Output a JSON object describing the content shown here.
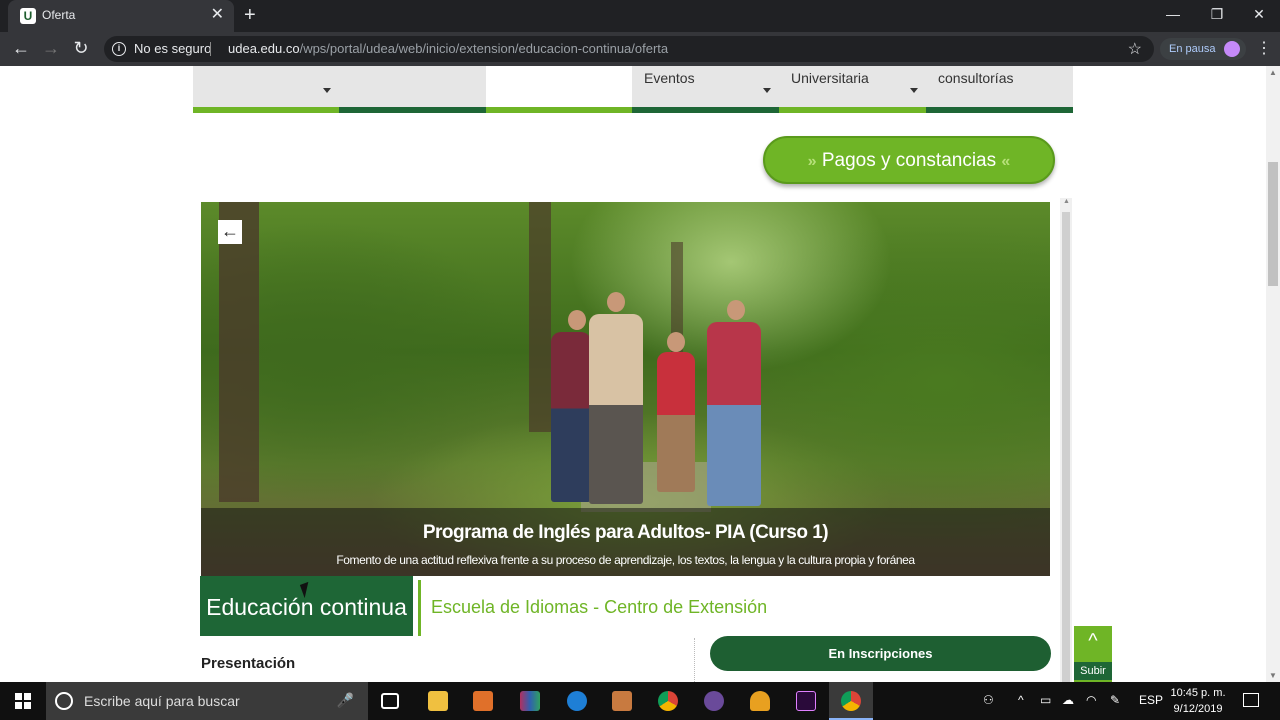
{
  "browser": {
    "tab_title": "Oferta",
    "tab_favicon_letter": "U",
    "close_symbol": "✕",
    "new_tab_symbol": "+",
    "security_label": "No es seguro",
    "url_host": "udea.edu.co",
    "url_path": "/wps/portal/udea/web/inicio/extension/educacion-continua/oferta",
    "profile_status": "En pausa"
  },
  "nav_menu": {
    "items": [
      {
        "label": ""
      },
      {
        "label": ""
      },
      {
        "label": ""
      },
      {
        "label": "Eventos"
      },
      {
        "label": "Universitaria"
      },
      {
        "label": "consultorías"
      }
    ]
  },
  "pagos_button": {
    "label": "Pagos y constancias",
    "left_chev": "»",
    "right_chev": "«"
  },
  "hero": {
    "title": "Programa de Inglés para Adultos- PIA (Curso 1)",
    "subtitle": "Fomento de una actitud reflexiva frente a su proceso de aprendizaje, los textos, la lengua y la cultura propia y foránea",
    "back_symbol": "←"
  },
  "section": {
    "category": "Educación continua",
    "school": "Escuela de Idiomas - Centro de Extensión",
    "status_button": "En Inscripciones",
    "presentation_heading": "Presentación"
  },
  "subir": {
    "arrow": "^",
    "label": "Subir"
  },
  "taskbar": {
    "search_placeholder": "Escribe aquí para buscar",
    "language": "ESP",
    "time": "10:45 p. m.",
    "date": "9/12/2019"
  },
  "colors": {
    "udea_green": "#1e6636",
    "accent_green": "#6fb526"
  }
}
